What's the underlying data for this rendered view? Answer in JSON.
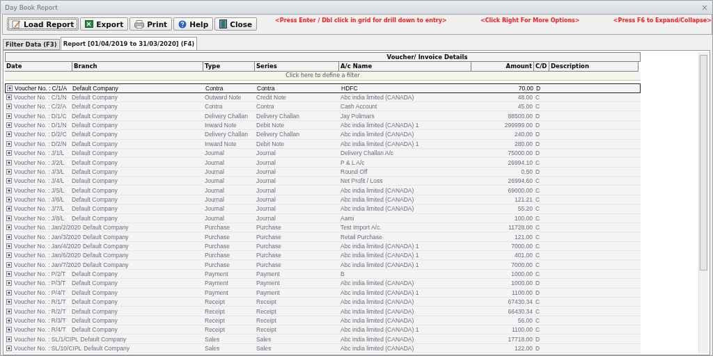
{
  "window": {
    "title": "Day Book Report",
    "close": "×"
  },
  "toolbar": {
    "buttons": [
      {
        "kind": "load",
        "label": "Load Report",
        "focused": true
      },
      {
        "kind": "export",
        "label": "Export",
        "focused": false
      },
      {
        "kind": "print",
        "label": "Print",
        "focused": false
      },
      {
        "kind": "help",
        "label": "Help",
        "focused": false
      },
      {
        "kind": "close",
        "label": "Close",
        "focused": false
      }
    ],
    "hints": [
      "<Press Enter / Dbl click in grid for drill down to entry>",
      "<Click Right For More Options>",
      "<Press F6 to Expand/Collapse>"
    ]
  },
  "tabs": [
    {
      "label": "Filter Data (F3)",
      "selected": false
    },
    {
      "label": "Report [01/04/2019 to 31/03/2020] (F4)",
      "selected": true
    }
  ],
  "grid": {
    "band": "Voucher/ Invoice Details",
    "columns": [
      "Date",
      "Branch",
      "Type",
      "Series",
      "A/c Name",
      "Amount",
      "C/D",
      "Description"
    ],
    "filter_row": "Click here to define a filter",
    "rows": [
      {
        "voucher": "Voucher No. : C/1/A",
        "branch": "Default Company",
        "type": "Contra",
        "series": "Contra",
        "account": "HDFC",
        "amount": "70.00",
        "cd": "D",
        "selected": true
      },
      {
        "voucher": "Voucher No. : C/1/N",
        "branch": "Default Company",
        "type": "Outward Note",
        "series": "Credit Note",
        "account": "Abc india limited (CANADA)",
        "amount": "48.00",
        "cd": "C",
        "selected": false
      },
      {
        "voucher": "Voucher No. : C/2/A",
        "branch": "Default Company",
        "type": "Contra",
        "series": "Contra",
        "account": "Cash Account",
        "amount": "45.00",
        "cd": "C",
        "selected": false
      },
      {
        "voucher": "Voucher No. : D/1/C",
        "branch": "Default Company",
        "type": "Delivery Challan",
        "series": "Delivery Challan",
        "account": "Jay Polimars",
        "amount": "88500.00",
        "cd": "D",
        "selected": false
      },
      {
        "voucher": "Voucher No. : D/1/N",
        "branch": "Default Company",
        "type": "Inward Note",
        "series": "Debit Note",
        "account": "Abc india limited (CANADA) 1",
        "amount": "299999.00",
        "cd": "D",
        "selected": false
      },
      {
        "voucher": "Voucher No. : D/2/C",
        "branch": "Default Company",
        "type": "Delivery Challan",
        "series": "Delivery Challan",
        "account": "Abc india limited (CANADA)",
        "amount": "240.00",
        "cd": "D",
        "selected": false
      },
      {
        "voucher": "Voucher No. : D/2/N",
        "branch": "Default Company",
        "type": "Inward Note",
        "series": "Debit Note",
        "account": "Abc india limited (CANADA) 1",
        "amount": "280.00",
        "cd": "D",
        "selected": false
      },
      {
        "voucher": "Voucher No. : J/1/L",
        "branch": "Default Company",
        "type": "Journal",
        "series": "Journal",
        "account": "Delivery Challan A/c",
        "amount": "75000.00",
        "cd": "D",
        "selected": false
      },
      {
        "voucher": "Voucher No. : J/2/L",
        "branch": "Default Company",
        "type": "Journal",
        "series": "Journal",
        "account": "P & L A/c",
        "amount": "26994.10",
        "cd": "C",
        "selected": false
      },
      {
        "voucher": "Voucher No. : J/3/L",
        "branch": "Default Company",
        "type": "Journal",
        "series": "Journal",
        "account": "Round Off",
        "amount": "0.50",
        "cd": "D",
        "selected": false
      },
      {
        "voucher": "Voucher No. : J/4/L",
        "branch": "Default Company",
        "type": "Journal",
        "series": "Journal",
        "account": "Net Profit / Loss",
        "amount": "26994.60",
        "cd": "C",
        "selected": false
      },
      {
        "voucher": "Voucher No. : J/5/L",
        "branch": "Default Company",
        "type": "Journal",
        "series": "Journal",
        "account": "Abc india limited (CANADA)",
        "amount": "69000.00",
        "cd": "C",
        "selected": false
      },
      {
        "voucher": "Voucher No. : J/6/L",
        "branch": "Default Company",
        "type": "Journal",
        "series": "Journal",
        "account": "Abc india limited (CANADA)",
        "amount": "121.21",
        "cd": "C",
        "selected": false
      },
      {
        "voucher": "Voucher No. : J/7/L",
        "branch": "Default Company",
        "type": "Journal",
        "series": "Journal",
        "account": "Abc india limited (CANADA)",
        "amount": "55.20",
        "cd": "C",
        "selected": false
      },
      {
        "voucher": "Voucher No. : J/8/L",
        "branch": "Default Company",
        "type": "Journal",
        "series": "Journal",
        "account": "Aami",
        "amount": "100.00",
        "cd": "C",
        "selected": false
      },
      {
        "voucher": "Voucher No. : Jan/2/2020",
        "branch": "Default Company",
        "type": "Purchase",
        "series": "Purchase",
        "account": "Test Import A/c.",
        "amount": "11728.00",
        "cd": "C",
        "selected": false
      },
      {
        "voucher": "Voucher No. : Jan/3/2020",
        "branch": "Default Company",
        "type": "Purchase",
        "series": "Purchase",
        "account": "Retail Purchase",
        "amount": "121.00",
        "cd": "C",
        "selected": false
      },
      {
        "voucher": "Voucher No. : Jan/4/2020",
        "branch": "Default Company",
        "type": "Purchase",
        "series": "Purchase",
        "account": "Abc india limited (CANADA) 1",
        "amount": "7000.00",
        "cd": "C",
        "selected": false
      },
      {
        "voucher": "Voucher No. : Jan/6/2020",
        "branch": "Default Company",
        "type": "Purchase",
        "series": "Purchase",
        "account": "Abc india limited (CANADA) 1",
        "amount": "401.00",
        "cd": "C",
        "selected": false
      },
      {
        "voucher": "Voucher No. : Jan/7/2020",
        "branch": "Default Company",
        "type": "Purchase",
        "series": "Purchase",
        "account": "Abc india limited (CANADA) 1",
        "amount": "7000.00",
        "cd": "C",
        "selected": false
      },
      {
        "voucher": "Voucher No. : P/2/T",
        "branch": "Default Company",
        "type": "Payment",
        "series": "Payment",
        "account": "B",
        "amount": "1000.00",
        "cd": "C",
        "selected": false
      },
      {
        "voucher": "Voucher No. : P/3/T",
        "branch": "Default Company",
        "type": "Payment",
        "series": "Payment",
        "account": "Abc india limited (CANADA)",
        "amount": "1000.00",
        "cd": "D",
        "selected": false
      },
      {
        "voucher": "Voucher No. : P/4/T",
        "branch": "Default Company",
        "type": "Payment",
        "series": "Payment",
        "account": "Abc india limited (CANADA) 1",
        "amount": "1100.00",
        "cd": "D",
        "selected": false
      },
      {
        "voucher": "Voucher No. : R/1/T",
        "branch": "Default Company",
        "type": "Receipt",
        "series": "Receipt",
        "account": "Abc india limited (CANADA)",
        "amount": "67430.34",
        "cd": "C",
        "selected": false
      },
      {
        "voucher": "Voucher No. : R/2/T",
        "branch": "Default Company",
        "type": "Receipt",
        "series": "Receipt",
        "account": "Abc india limited (CANADA)",
        "amount": "66430.34",
        "cd": "C",
        "selected": false
      },
      {
        "voucher": "Voucher No. : R/3/T",
        "branch": "Default Company",
        "type": "Receipt",
        "series": "Receipt",
        "account": "Abc india limited (CANADA)",
        "amount": "56.00",
        "cd": "C",
        "selected": false
      },
      {
        "voucher": "Voucher No. : R/4/T",
        "branch": "Default Company",
        "type": "Receipt",
        "series": "Receipt",
        "account": "Abc india limited (CANADA) 1",
        "amount": "1100.00",
        "cd": "C",
        "selected": false
      },
      {
        "voucher": "Voucher No. : SL/1/CIPL",
        "branch": "Default Company",
        "type": "Sales",
        "series": "Sales",
        "account": "Abc india limited (CANADA)",
        "amount": "17718.00",
        "cd": "D",
        "selected": false
      },
      {
        "voucher": "Voucher No. : SL/10/CIPL",
        "branch": "Default Company",
        "type": "Sales",
        "series": "Sales",
        "account": "Abc india limited (CANADA)",
        "amount": "122.00",
        "cd": "D",
        "selected": false
      }
    ]
  }
}
